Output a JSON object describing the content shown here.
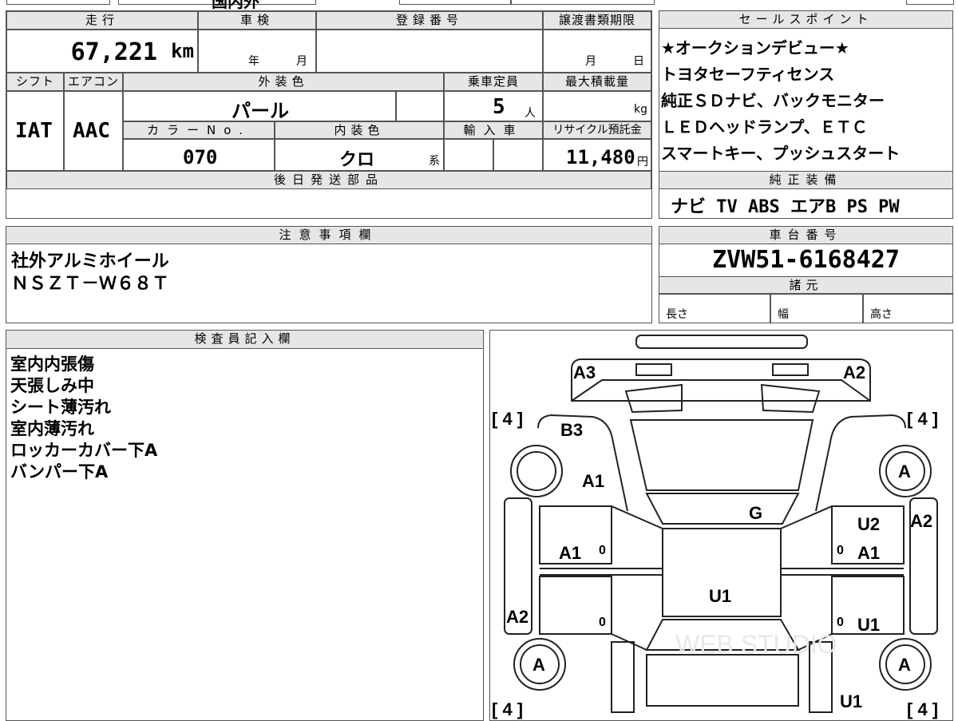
{
  "top_strip": {
    "title_fragment": "国内外"
  },
  "vehicle": {
    "mileage_label": "走行",
    "mileage_value": "67,221",
    "mileage_unit": "km",
    "inspection_label": "車検",
    "inspection_year_suffix": "年",
    "inspection_month_suffix": "月",
    "registration_label": "登録番号",
    "transfer_deadline_label": "譲渡書類期限",
    "transfer_month_suffix": "月",
    "transfer_day_suffix": "日",
    "shift_label": "シフト",
    "shift_value": "IAT",
    "aircon_label": "エアコン",
    "aircon_value": "AAC",
    "exterior_color_label": "外装色",
    "exterior_color_value": "パール",
    "capacity_label": "乗車定員",
    "capacity_value": "5",
    "capacity_unit": "人",
    "max_load_label": "最大積載量",
    "max_load_unit": "kg",
    "color_no_label": "カラーNo.",
    "color_no_value": "070",
    "interior_color_label": "内装色",
    "interior_color_value": "クロ",
    "interior_color_suffix": "系",
    "import_label": "輸入車",
    "recycle_label": "リサイクル預託金",
    "recycle_value": "11,480",
    "recycle_unit": "円",
    "later_parts_label": "後日発送部品"
  },
  "sales_points": {
    "label": "セールスポイント",
    "items": [
      "★オークションデビュー★",
      "トヨタセーフティセンス",
      "純正ＳＤナビ、バックモニター",
      "ＬＥＤヘッドランプ、ＥＴＣ",
      "スマートキー、プッシュスタート"
    ]
  },
  "genuine_equipment": {
    "label": "純正装備",
    "value": "ナビ TV ABS エアB PS PW"
  },
  "notes": {
    "label": "注意事項欄",
    "lines": [
      "社外アルミホイール",
      "ＮＳＺＴ－Ｗ６８Ｔ"
    ]
  },
  "chassis": {
    "label": "車台番号",
    "value": "ZVW51-6168427",
    "specs_label": "諸元",
    "length_label": "長さ",
    "width_label": "幅",
    "height_label": "高さ"
  },
  "inspector": {
    "label": "検査員記入欄",
    "lines": [
      "室内内張傷",
      "天張しみ中",
      "シート薄汚れ",
      "室内薄汚れ",
      "ロッカーカバー下A",
      "バンパー下A"
    ]
  },
  "diagram": {
    "tire_left_top": "[ 4 ]",
    "tire_right_top": "[ 4 ]",
    "tire_left_bottom": "[ 4 ]",
    "tire_right_bottom": "[ 4 ]",
    "marks": {
      "front_left": "A3",
      "front_right": "A2",
      "left_fender": "B3",
      "left_front_door": "A1",
      "left_rear_door": "A1",
      "left_quarter": "A2",
      "glass": "G",
      "roof": "U1",
      "right_fender": "U2",
      "right_front_door": "A1",
      "right_quarter": "A2",
      "right_rear_door": "U1",
      "right_rear_bottom": "U1",
      "wheel_right_front": "A",
      "wheel_left_rear": "A",
      "wheel_right_rear": "A",
      "zero_1": "0",
      "zero_2": "0",
      "zero_3": "0",
      "zero_4": "0"
    },
    "watermark": "WEB STUDIO"
  }
}
